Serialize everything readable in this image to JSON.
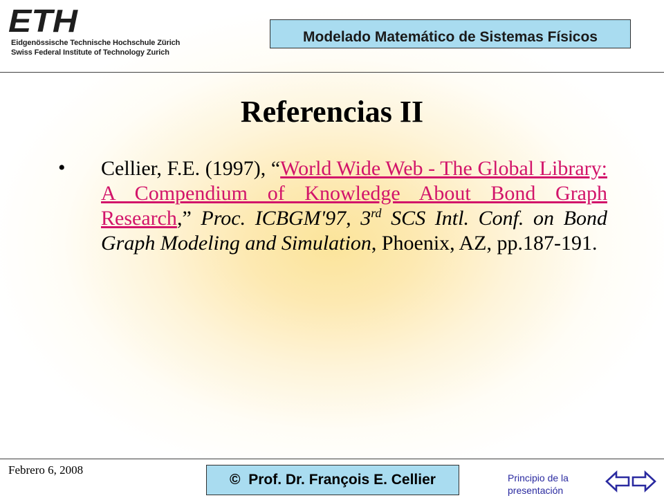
{
  "header": {
    "logo_mark": "ETH",
    "logo_line_1": "Eidgenössische Technische Hochschule Zürich",
    "logo_line_2": "Swiss Federal Institute of Technology Zurich",
    "course_title": "Modelado Matemático de Sistemas Físicos"
  },
  "slide": {
    "title": "Referencias II",
    "reference": {
      "authors_year": "Cellier, F.E. (1997), “",
      "link_text": "World Wide Web - The Global Library: A Compendium of Knowledge About Bond Graph Research",
      "after_link": ",” ",
      "venue_part1": "Proc. ICBGM'97, 3",
      "venue_sup": "rd",
      "venue_part2": " SCS Intl. Conf. on Bond Graph Modeling and Simulation",
      "tail": ", Phoenix, AZ, pp.187-191."
    }
  },
  "footer": {
    "date": "Febrero 6, 2008",
    "copyright": "©  Prof. Dr. François E. Cellier",
    "home_link": "Principio de la presentación"
  },
  "colors": {
    "accent_box": "#a9dcf0",
    "link": "#d2146a",
    "nav_arrow": "#2a2aa0"
  },
  "icons": {
    "prev": "arrow-left-outline-icon",
    "next": "arrow-right-outline-icon"
  }
}
